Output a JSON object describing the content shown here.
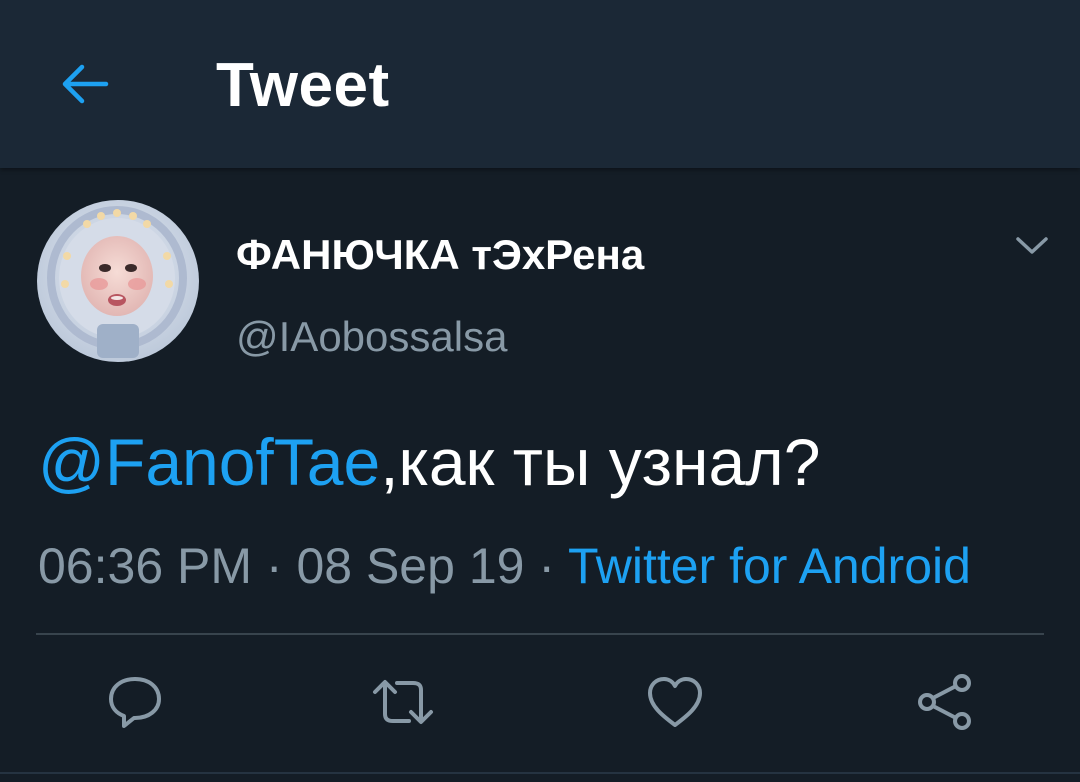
{
  "header": {
    "title": "Tweet",
    "back_icon": "arrow-left-icon"
  },
  "tweet": {
    "author": {
      "display_name": "ФАНЮЧКА тЭхРена",
      "handle": "@IAobossalsa"
    },
    "body": {
      "mention": "@FanofTae",
      "text": ",как ты узнал?"
    },
    "meta": {
      "time": "06:36 PM",
      "sep1": " · ",
      "date": "08 Sep 19",
      "sep2": " · ",
      "source": "Twitter for Android"
    },
    "actions": [
      {
        "icon": "reply-icon"
      },
      {
        "icon": "retweet-icon"
      },
      {
        "icon": "like-icon"
      },
      {
        "icon": "share-icon"
      }
    ]
  },
  "colors": {
    "accent": "#1da1f2",
    "background": "#141d26",
    "header_bg": "#1b2836",
    "secondary_text": "#8899a6",
    "icon_gray": "#8899a6",
    "divider": "#38444d"
  }
}
